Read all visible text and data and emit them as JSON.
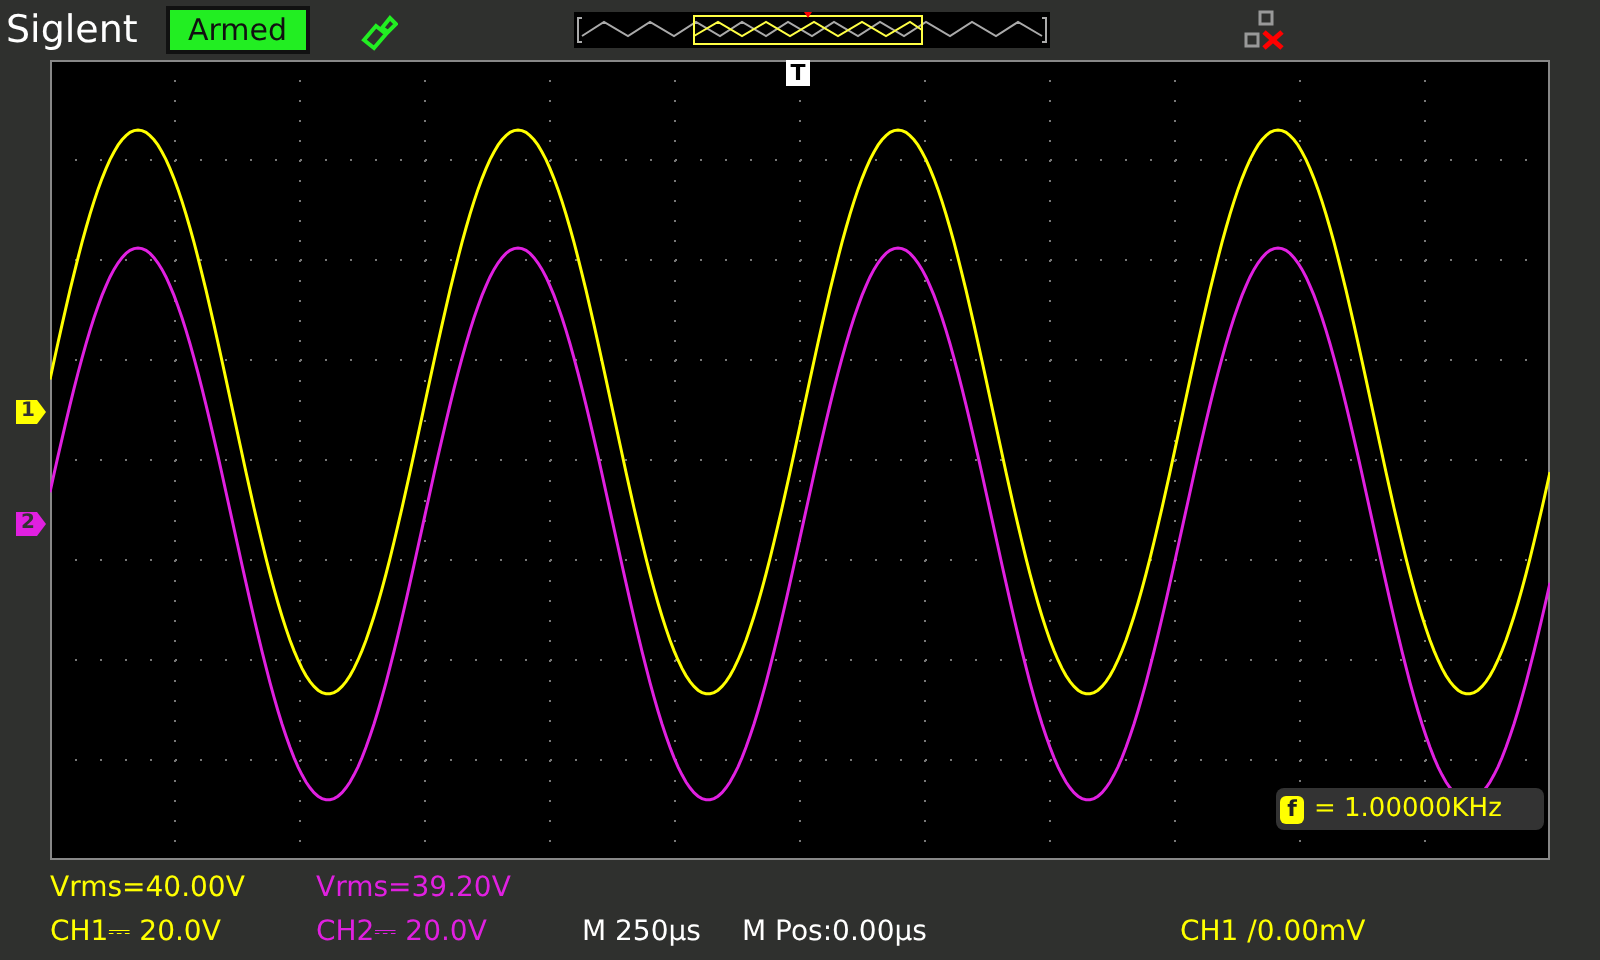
{
  "header": {
    "brand": "Siglent",
    "status": "Armed"
  },
  "trigger_marker": "T",
  "channels": [
    {
      "marker": "1",
      "color": "#ffff00",
      "measurement": "Vrms=40.00V",
      "scale": "CH1⎓ 20.0V"
    },
    {
      "marker": "2",
      "color": "#e020e0",
      "measurement": "Vrms=39.20V",
      "scale": "CH2⎓ 20.0V"
    }
  ],
  "timebase": {
    "scale": "M 250µs",
    "position": "M Pos:0.00µs"
  },
  "trigger": "CH1 /0.00mV",
  "frequency": {
    "badge": "f",
    "reading": "= 1.00000KHz"
  }
}
